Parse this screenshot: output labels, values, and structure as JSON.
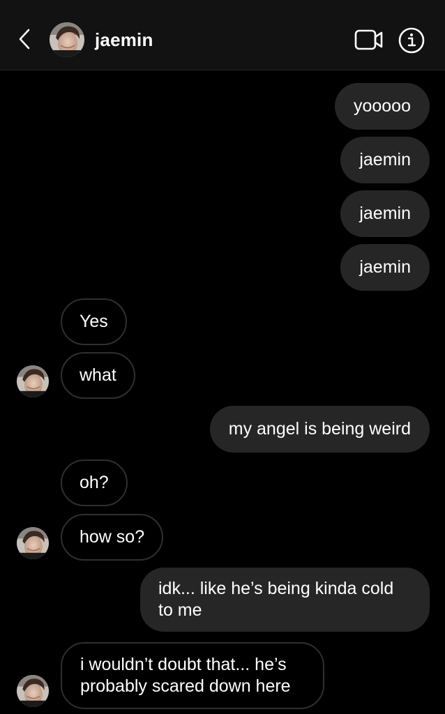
{
  "header": {
    "contact_name": "jaemin",
    "icons": {
      "back": "chevron-left-icon",
      "video": "video-camera-icon",
      "info": "info-icon"
    }
  },
  "messages": [
    {
      "side": "sent",
      "text": "yooooo"
    },
    {
      "side": "sent",
      "text": "jaemin"
    },
    {
      "side": "sent",
      "text": "jaemin"
    },
    {
      "side": "sent",
      "text": "jaemin"
    },
    {
      "side": "received",
      "text": "Yes"
    },
    {
      "side": "received",
      "text": "what"
    },
    {
      "side": "sent",
      "text": "my angel is being weird"
    },
    {
      "side": "received",
      "text": "oh?"
    },
    {
      "side": "received",
      "text": "how so?"
    },
    {
      "side": "sent",
      "text": "idk... like he’s being kinda cold to me"
    },
    {
      "side": "received",
      "text": "i wouldn’t doubt that... he’s probably scared down here"
    }
  ],
  "colors": {
    "background": "#000000",
    "header_bg": "#121212",
    "sent_bubble": "#262626",
    "received_border": "#2f2f2f",
    "text": "#ffffff"
  }
}
